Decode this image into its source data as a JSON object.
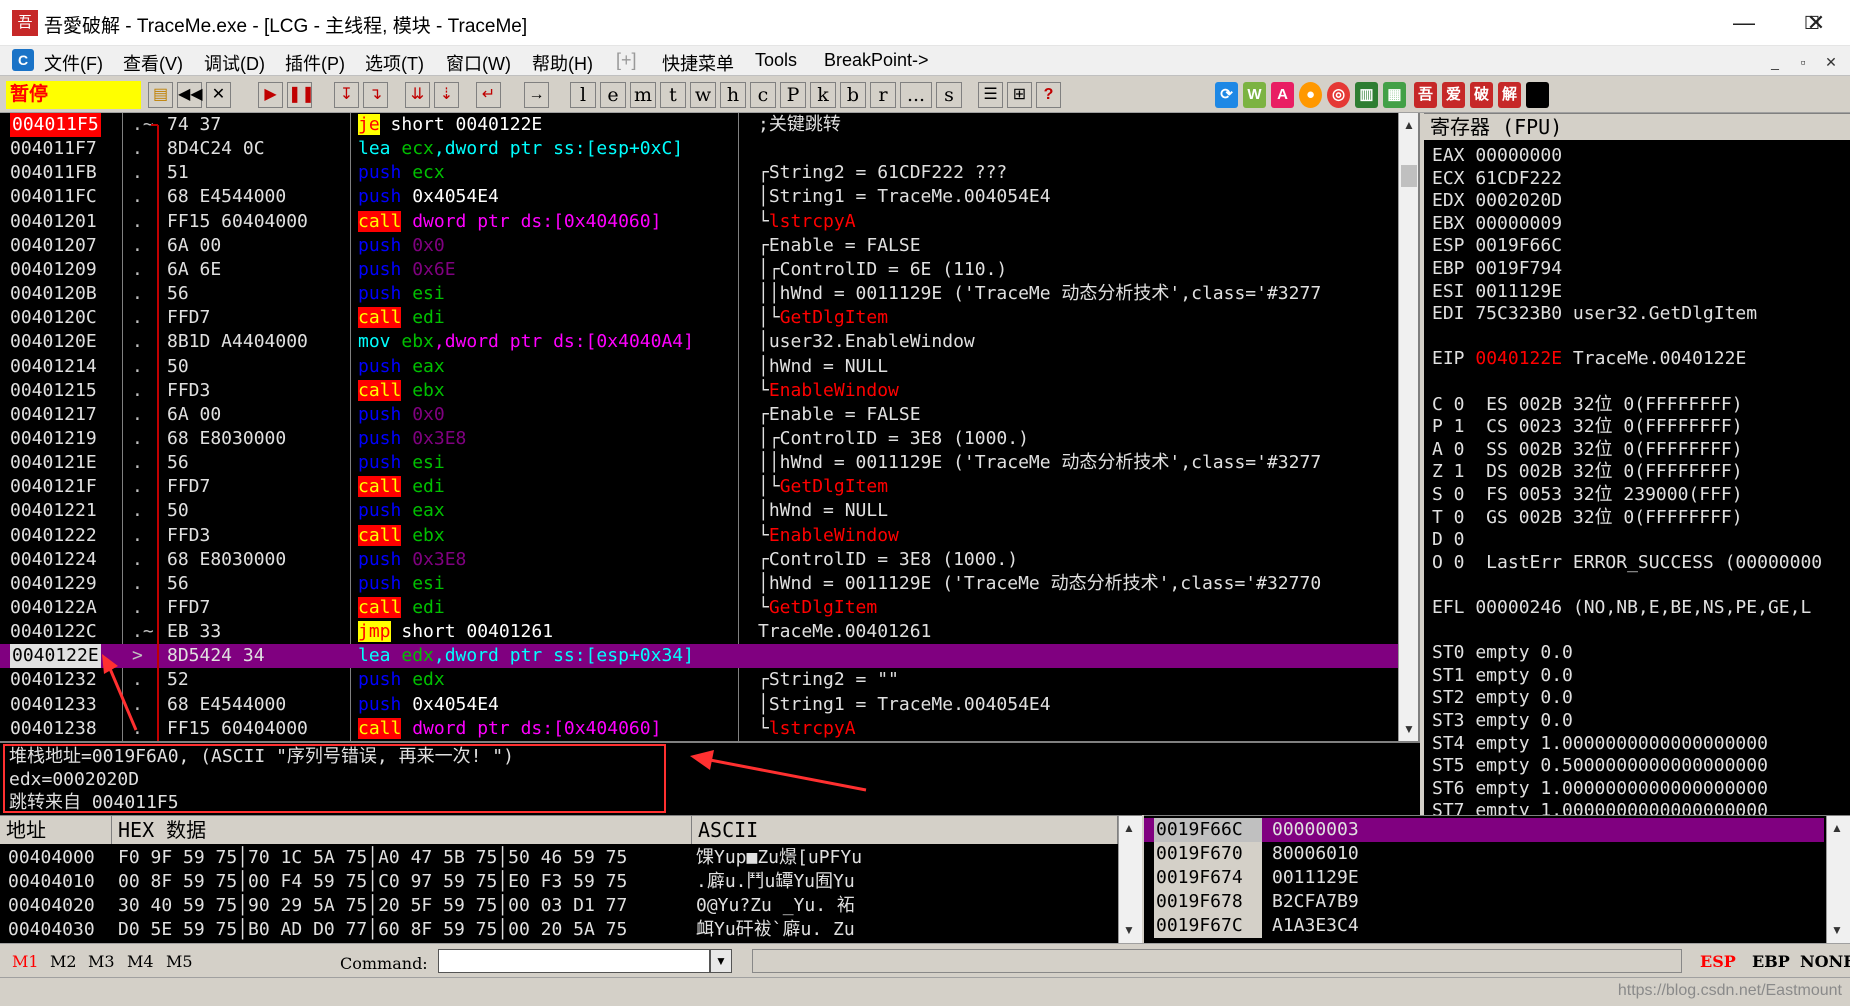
{
  "window": {
    "title": "吾愛破解 - TraceMe.exe - [LCG - 主线程, 模块 - TraceMe]",
    "icon_text": "吾",
    "min_icon": "—",
    "max_icon": "☐",
    "close_icon": "✕"
  },
  "menu": {
    "app_icon": "C",
    "items": [
      "文件(F)",
      "查看(V)",
      "调试(D)",
      "插件(P)",
      "选项(T)",
      "窗口(W)",
      "帮助(H)",
      "[+]",
      "快捷菜单",
      "Tools",
      "BreakPoint->"
    ],
    "mdi": [
      "_",
      "▫",
      "✕"
    ]
  },
  "toolbar": {
    "status": "暂停",
    "letters": [
      "l",
      "e",
      "m",
      "t",
      "w",
      "h",
      "c",
      "P",
      "k",
      "b",
      "r",
      "...",
      "s"
    ],
    "plugin_labels": [
      "吾",
      "爱",
      "破",
      "解"
    ],
    "help_label": "?"
  },
  "cpu_rows": [
    {
      "addr": "004011F5",
      "sym": ".~",
      "hex": "74 37",
      "asm": [
        {
          "t": "je",
          "c": "k-jmp"
        },
        {
          "t": " short 0040122E",
          "c": "op-y"
        }
      ],
      "com": [
        {
          "t": ";关键跳转",
          "c": "cm-white"
        }
      ]
    },
    {
      "addr": "004011F7",
      "sym": ".",
      "hex": "8D4C24 0C",
      "asm": [
        {
          "t": "lea ",
          "c": "k-lea"
        },
        {
          "t": "ecx",
          "c": "op-ecx"
        },
        {
          "t": ",dword ptr ss:[esp+0xC]",
          "c": "k-lea"
        }
      ],
      "com": []
    },
    {
      "addr": "004011FB",
      "sym": ".",
      "hex": "51",
      "asm": [
        {
          "t": "push ",
          "c": "k-push-x"
        },
        {
          "t": "ecx",
          "c": "op-g"
        }
      ],
      "com": [
        {
          "t": "┌String2 = 61CDF222 ???",
          "c": "cm-white"
        }
      ]
    },
    {
      "addr": "004011FC",
      "sym": ".",
      "hex": "68 E4544000",
      "asm": [
        {
          "t": "push ",
          "c": "k-push-x"
        },
        {
          "t": "0x4054E4",
          "c": "op-y"
        }
      ],
      "com": [
        {
          "t": "│String1 = TraceMe.004054E4",
          "c": "cm-white"
        }
      ]
    },
    {
      "addr": "00401201",
      "sym": ".",
      "hex": "FF15 60404000",
      "asm": [
        {
          "t": "call",
          "c": "k-call"
        },
        {
          "t": " dword ptr ds:[0x404060]",
          "c": "op-p"
        }
      ],
      "com": [
        {
          "t": "└",
          "c": "cm-white"
        },
        {
          "t": "lstrcpyA",
          "c": "cm-red"
        }
      ]
    },
    {
      "addr": "00401207",
      "sym": ".",
      "hex": "6A 00",
      "asm": [
        {
          "t": "push ",
          "c": "k-push-x"
        },
        {
          "t": "0x0",
          "c": "op-v"
        }
      ],
      "com": [
        {
          "t": "┌Enable = FALSE",
          "c": "cm-white"
        }
      ]
    },
    {
      "addr": "00401209",
      "sym": ".",
      "hex": "6A 6E",
      "asm": [
        {
          "t": "push ",
          "c": "k-push-x"
        },
        {
          "t": "0x6E",
          "c": "op-v"
        }
      ],
      "com": [
        {
          "t": "│┌ControlID = 6E (110.)",
          "c": "cm-white"
        }
      ]
    },
    {
      "addr": "0040120B",
      "sym": ".",
      "hex": "56",
      "asm": [
        {
          "t": "push ",
          "c": "k-push-x"
        },
        {
          "t": "esi",
          "c": "op-g"
        }
      ],
      "com": [
        {
          "t": "││hWnd = 0011129E ('TraceMe 动态分析技术',class='#3277",
          "c": "cm-white"
        }
      ]
    },
    {
      "addr": "0040120C",
      "sym": ".",
      "hex": "FFD7",
      "asm": [
        {
          "t": "call",
          "c": "k-call"
        },
        {
          "t": " edi",
          "c": "op-g"
        }
      ],
      "com": [
        {
          "t": "│└",
          "c": "cm-white"
        },
        {
          "t": "GetDlgItem",
          "c": "cm-red"
        }
      ]
    },
    {
      "addr": "0040120E",
      "sym": ".",
      "hex": "8B1D A4404000",
      "asm": [
        {
          "t": "mov ",
          "c": "k-mov"
        },
        {
          "t": "ebx",
          "c": "op-g"
        },
        {
          "t": ",dword ptr ds:[0x4040A4]",
          "c": "op-p"
        }
      ],
      "com": [
        {
          "t": "│user32.EnableWindow",
          "c": "cm-white"
        }
      ]
    },
    {
      "addr": "00401214",
      "sym": ".",
      "hex": "50",
      "asm": [
        {
          "t": "push ",
          "c": "k-push-x"
        },
        {
          "t": "eax",
          "c": "op-g"
        }
      ],
      "com": [
        {
          "t": "│hWnd = NULL",
          "c": "cm-white"
        }
      ]
    },
    {
      "addr": "00401215",
      "sym": ".",
      "hex": "FFD3",
      "asm": [
        {
          "t": "call",
          "c": "k-call"
        },
        {
          "t": " ebx",
          "c": "op-g"
        }
      ],
      "com": [
        {
          "t": "└",
          "c": "cm-white"
        },
        {
          "t": "EnableWindow",
          "c": "cm-red"
        }
      ]
    },
    {
      "addr": "00401217",
      "sym": ".",
      "hex": "6A 00",
      "asm": [
        {
          "t": "push ",
          "c": "k-push-x"
        },
        {
          "t": "0x0",
          "c": "op-v"
        }
      ],
      "com": [
        {
          "t": "┌Enable = FALSE",
          "c": "cm-white"
        }
      ]
    },
    {
      "addr": "00401219",
      "sym": ".",
      "hex": "68 E8030000",
      "asm": [
        {
          "t": "push ",
          "c": "k-push-x"
        },
        {
          "t": "0x3E8",
          "c": "op-v"
        }
      ],
      "com": [
        {
          "t": "│┌ControlID = 3E8 (1000.)",
          "c": "cm-white"
        }
      ]
    },
    {
      "addr": "0040121E",
      "sym": ".",
      "hex": "56",
      "asm": [
        {
          "t": "push ",
          "c": "k-push-x"
        },
        {
          "t": "esi",
          "c": "op-g"
        }
      ],
      "com": [
        {
          "t": "││hWnd = 0011129E ('TraceMe 动态分析技术',class='#3277",
          "c": "cm-white"
        }
      ]
    },
    {
      "addr": "0040121F",
      "sym": ".",
      "hex": "FFD7",
      "asm": [
        {
          "t": "call",
          "c": "k-call"
        },
        {
          "t": " edi",
          "c": "op-g"
        }
      ],
      "com": [
        {
          "t": "│└",
          "c": "cm-white"
        },
        {
          "t": "GetDlgItem",
          "c": "cm-red"
        }
      ]
    },
    {
      "addr": "00401221",
      "sym": ".",
      "hex": "50",
      "asm": [
        {
          "t": "push ",
          "c": "k-push-x"
        },
        {
          "t": "eax",
          "c": "op-g"
        }
      ],
      "com": [
        {
          "t": "│hWnd = NULL",
          "c": "cm-white"
        }
      ]
    },
    {
      "addr": "00401222",
      "sym": ".",
      "hex": "FFD3",
      "asm": [
        {
          "t": "call",
          "c": "k-call"
        },
        {
          "t": " ebx",
          "c": "op-g"
        }
      ],
      "com": [
        {
          "t": "└",
          "c": "cm-white"
        },
        {
          "t": "EnableWindow",
          "c": "cm-red"
        }
      ]
    },
    {
      "addr": "00401224",
      "sym": ".",
      "hex": "68 E8030000",
      "asm": [
        {
          "t": "push ",
          "c": "k-push-x"
        },
        {
          "t": "0x3E8",
          "c": "op-v"
        }
      ],
      "com": [
        {
          "t": "┌ControlID = 3E8 (1000.)",
          "c": "cm-white"
        }
      ]
    },
    {
      "addr": "00401229",
      "sym": ".",
      "hex": "56",
      "asm": [
        {
          "t": "push ",
          "c": "k-push-x"
        },
        {
          "t": "esi",
          "c": "op-g"
        }
      ],
      "com": [
        {
          "t": "│hWnd = 0011129E ('TraceMe 动态分析技术',class='#32770",
          "c": "cm-white"
        }
      ]
    },
    {
      "addr": "0040122A",
      "sym": ".",
      "hex": "FFD7",
      "asm": [
        {
          "t": "call",
          "c": "k-call"
        },
        {
          "t": " edi",
          "c": "op-g"
        }
      ],
      "com": [
        {
          "t": "└",
          "c": "cm-white"
        },
        {
          "t": "GetDlgItem",
          "c": "cm-red"
        }
      ]
    },
    {
      "addr": "0040122C",
      "sym": ".~",
      "hex": "EB 33",
      "asm": [
        {
          "t": "jmp",
          "c": "k-jmp"
        },
        {
          "t": " short 00401261",
          "c": "op-y"
        }
      ],
      "com": [
        {
          "t": "TraceMe.00401261",
          "c": "cm-white"
        }
      ]
    },
    {
      "addr": "0040122E",
      "sym": ">",
      "hex": "8D5424 34",
      "asm": [
        {
          "t": "lea ",
          "c": "k-lea"
        },
        {
          "t": "edx",
          "c": "op-g"
        },
        {
          "t": ",dword ptr ss:[esp+0x34]",
          "c": "k-lea"
        }
      ],
      "com": []
    },
    {
      "addr": "00401232",
      "sym": ".",
      "hex": "52",
      "asm": [
        {
          "t": "push ",
          "c": "k-push-x"
        },
        {
          "t": "edx",
          "c": "op-g"
        }
      ],
      "com": [
        {
          "t": "┌String2 = \"\"",
          "c": "cm-white"
        }
      ]
    },
    {
      "addr": "00401233",
      "sym": ".",
      "hex": "68 E4544000",
      "asm": [
        {
          "t": "push ",
          "c": "k-push-x"
        },
        {
          "t": "0x4054E4",
          "c": "op-y"
        }
      ],
      "com": [
        {
          "t": "│String1 = TraceMe.004054E4",
          "c": "cm-white"
        }
      ]
    },
    {
      "addr": "00401238",
      "sym": ".",
      "hex": "FF15 60404000",
      "asm": [
        {
          "t": "call",
          "c": "k-call"
        },
        {
          "t": " dword ptr ds:[0x404060]",
          "c": "op-p"
        }
      ],
      "com": [
        {
          "t": "└",
          "c": "cm-white"
        },
        {
          "t": "lstrcpyA",
          "c": "cm-red"
        }
      ]
    }
  ],
  "registers": {
    "header": "寄存器 (FPU)",
    "lines": [
      [
        {
          "t": "EAX 00000000"
        }
      ],
      [
        {
          "t": "ECX 61CDF222"
        }
      ],
      [
        {
          "t": "EDX 0002020D"
        }
      ],
      [
        {
          "t": "EBX 00000009"
        }
      ],
      [
        {
          "t": "ESP 0019F66C"
        }
      ],
      [
        {
          "t": "EBP 0019F794"
        }
      ],
      [
        {
          "t": "ESI 0011129E"
        }
      ],
      [
        {
          "t": "EDI 75C323B0 user32.GetDlgItem"
        }
      ],
      [],
      [
        {
          "t": "EIP "
        },
        {
          "t": "0040122E",
          "red": true
        },
        {
          "t": " TraceMe.0040122E"
        }
      ],
      [],
      [
        {
          "t": "C 0  ES 002B 32位 0(FFFFFFFF)"
        }
      ],
      [
        {
          "t": "P 1  CS 0023 32位 0(FFFFFFFF)"
        }
      ],
      [
        {
          "t": "A 0  SS 002B 32位 0(FFFFFFFF)"
        }
      ],
      [
        {
          "t": "Z 1  DS 002B 32位 0(FFFFFFFF)"
        }
      ],
      [
        {
          "t": "S 0  FS 0053 32位 239000(FFF)"
        }
      ],
      [
        {
          "t": "T 0  GS 002B 32位 0(FFFFFFFF)"
        }
      ],
      [
        {
          "t": "D 0"
        }
      ],
      [
        {
          "t": "O 0  LastErr ERROR_SUCCESS (00000000"
        }
      ],
      [],
      [
        {
          "t": "EFL 00000246 (NO,NB,E,BE,NS,PE,GE,L"
        }
      ],
      [],
      [
        {
          "t": "ST0 empty 0.0"
        }
      ],
      [
        {
          "t": "ST1 empty 0.0"
        }
      ],
      [
        {
          "t": "ST2 empty 0.0"
        }
      ],
      [
        {
          "t": "ST3 empty 0.0"
        }
      ],
      [
        {
          "t": "ST4 empty 1.0000000000000000000"
        }
      ],
      [
        {
          "t": "ST5 empty 0.5000000000000000000"
        }
      ],
      [
        {
          "t": "ST6 empty 1.0000000000000000000"
        }
      ],
      [
        {
          "t": "ST7 empty 1.0000000000000000000"
        }
      ]
    ]
  },
  "info": {
    "lines": [
      "堆栈地址=0019F6A0, (ASCII \"序列号错误, 再来一次! \")",
      "edx=0002020D",
      "跳转来自 004011F5"
    ]
  },
  "dump": {
    "headers": [
      "地址",
      "HEX 数据",
      "ASCII"
    ],
    "rows": [
      {
        "addr": "00404000",
        "hex": "F0 9F 59 75│70 1C 5A 75│A0 47 5B 75│50 46 59 75",
        "ascii": "馃Yup■Zu燝[uPFYu"
      },
      {
        "addr": "00404010",
        "hex": "00 8F 59 75│00 F4 59 75│C0 97 59 75│E0 F3 59 75",
        "ascii": ".廦u.鬥u罈Yu囿Yu"
      },
      {
        "addr": "00404020",
        "hex": "30 40 59 75│90 29 5A 75│20 5F 59 75│00 03 D1 77",
        "ascii": "0@Yu?Zu _Yu. 袥"
      },
      {
        "addr": "00404030",
        "hex": "D0 5E 59 75│B0 AD D0 77│60 8F 59 75│00 20 5A 75",
        "ascii": "衈Yu矸袚`廦u. Zu"
      }
    ]
  },
  "stack": {
    "rows": [
      {
        "addr": "0019F66C",
        "val": "00000003",
        "sel": true
      },
      {
        "addr": "0019F670",
        "val": "80006010",
        "sel": false
      },
      {
        "addr": "0019F674",
        "val": "0011129E",
        "sel": false
      },
      {
        "addr": "0019F678",
        "val": "B2CFA7B9",
        "sel": false
      },
      {
        "addr": "0019F67C",
        "val": "A1A3E3C4",
        "sel": false
      }
    ]
  },
  "bottom": {
    "mtabs": [
      "M1",
      "M2",
      "M3",
      "M4",
      "M5"
    ],
    "command_label": "Command:",
    "command_value": "",
    "rtabs": [
      "ESP",
      "EBP",
      "NONE"
    ]
  },
  "status": {
    "watermark": "https://blog.csdn.net/Eastmount"
  },
  "colors": {
    "accent_red": "#ff0000",
    "selection": "#800080",
    "pause_bg": "#ffff00"
  }
}
